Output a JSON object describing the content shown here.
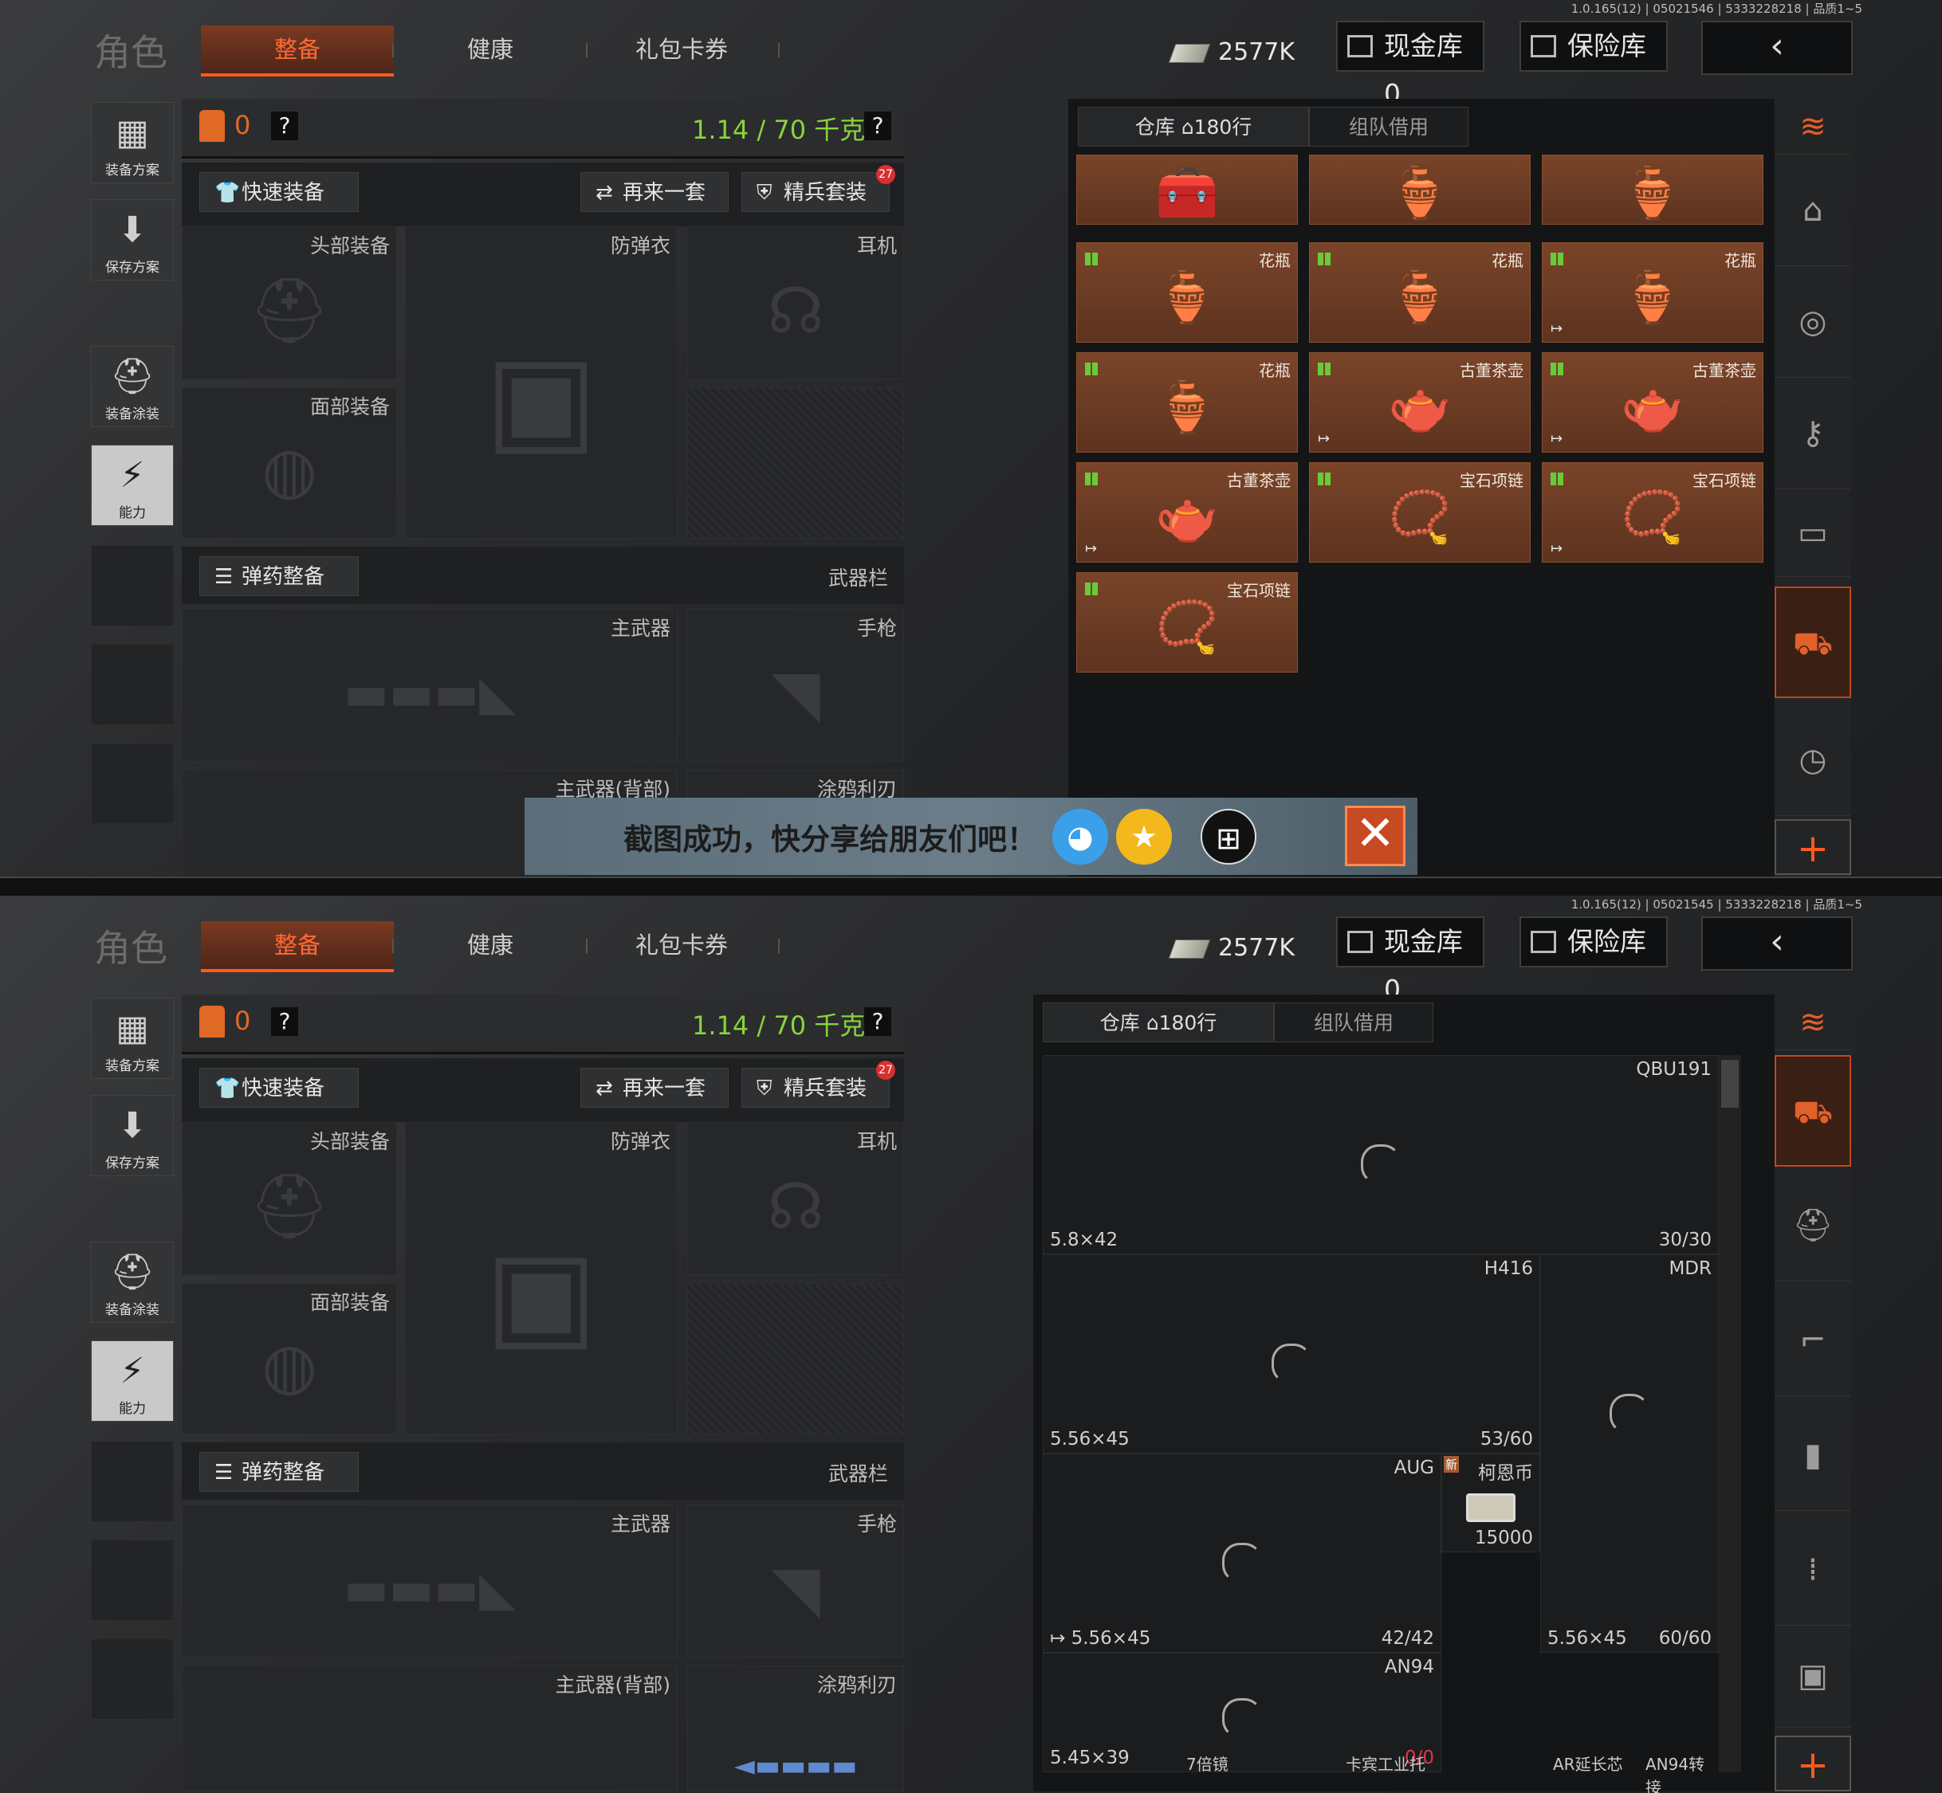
{
  "version": "1.0.165(12) | 05021546 | 5333228218 | 品质1~5",
  "version2": "1.0.165(12) | 05021545 | 5333228218 | 品质1~5",
  "tabs": {
    "role": "角色",
    "equip": "整备",
    "health": "健康",
    "gift": "礼包卡券"
  },
  "currency": "2577K",
  "cash_vault": "现金库 0",
  "safe": "保险库",
  "back": "‹",
  "left_sidebar": {
    "plan": "装备方案",
    "save": "保存方案",
    "skin": "装备涂装",
    "ability": "能力"
  },
  "equip": {
    "vest_count": "0",
    "help": "?",
    "weight": "1.14 / 70 千克",
    "quick_equip": "快速装备",
    "again": "再来一套",
    "elite": "精兵套装",
    "elite_badge": "27",
    "slots": {
      "head": "头部装备",
      "armor": "防弹衣",
      "earphone": "耳机",
      "face": "面部装备",
      "primary": "主武器",
      "pistol": "手枪",
      "primary_back": "主武器(背部)",
      "melee": "涂鸦利刃"
    },
    "ammo": "弹药整备",
    "weapon_bar": "武器栏"
  },
  "toast": {
    "text": "截图成功，快分享给朋友们吧！"
  },
  "storage": {
    "tab_storage": "仓库",
    "rows": "180行",
    "tab_team": "组队借用",
    "items": [
      "",
      "",
      "",
      "花瓶",
      "花瓶",
      "花瓶",
      "花瓶",
      "古董茶壶",
      "古董茶壶",
      "古董茶壶",
      "宝石项链",
      "宝石项链",
      "宝石项链"
    ]
  },
  "grid": {
    "qbu": {
      "name": "QBU191",
      "cal": "5.8×42",
      "cnt": "30/30"
    },
    "h416": {
      "name": "H416",
      "cal": "5.56×45",
      "cnt": "53/60"
    },
    "mdr": {
      "name": "MDR",
      "cal": "5.56×45",
      "cnt": "60/60"
    },
    "aug": {
      "name": "AUG",
      "cal": "5.56×45",
      "cnt": "42/42"
    },
    "coin": {
      "new": "新",
      "name": "柯恩币",
      "cnt": "15000"
    },
    "an94": {
      "name": "AN94",
      "cal": "5.45×39",
      "cnt": "0/0"
    },
    "bottom": [
      "7倍镜",
      "卡宾工业托",
      "AR延长芯",
      "AN94转接"
    ]
  },
  "colors": {
    "accent": "#ff5a1f",
    "weight": "#8bd23d",
    "item_bg": "#6b3a24",
    "badge": "#d83030"
  }
}
